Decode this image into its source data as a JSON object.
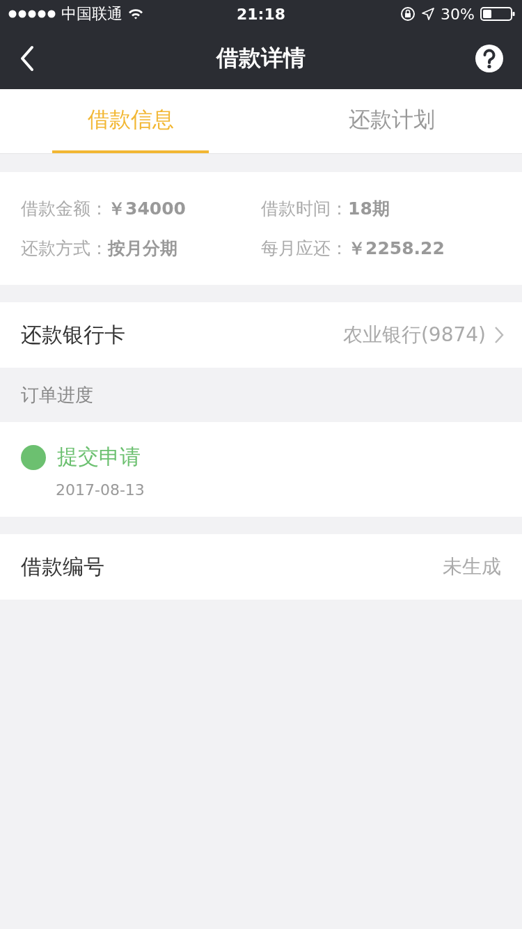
{
  "status_bar": {
    "carrier": "中国联通",
    "time": "21:18",
    "battery": "30%"
  },
  "nav": {
    "title": "借款详情"
  },
  "tabs": [
    {
      "label": "借款信息",
      "selected": true
    },
    {
      "label": "还款计划",
      "selected": false
    }
  ],
  "loan_info": [
    {
      "label": "借款金额：",
      "value": "￥34000"
    },
    {
      "label": "借款时间：",
      "value": "18期"
    },
    {
      "label": "还款方式：",
      "value": "按月分期"
    },
    {
      "label": "每月应还：",
      "value": "￥2258.22"
    }
  ],
  "bank_card": {
    "label": "还款银行卡",
    "value": "农业银行(9874)"
  },
  "progress": {
    "title": "订单进度",
    "steps": [
      {
        "label": "提交申请",
        "date": "2017-08-13",
        "color": "#6cc070"
      }
    ]
  },
  "loan_number": {
    "label": "借款编号",
    "value": "未生成"
  }
}
